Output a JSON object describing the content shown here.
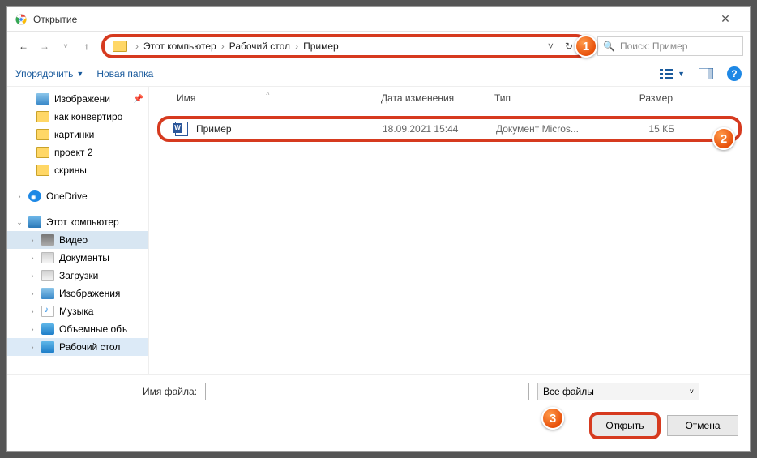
{
  "window": {
    "title": "Открытие"
  },
  "breadcrumb": {
    "p1": "Этот компьютер",
    "p2": "Рабочий стол",
    "p3": "Пример"
  },
  "search": {
    "placeholder": "Поиск: Пример"
  },
  "toolbar": {
    "organize": "Упорядочить",
    "newfolder": "Новая папка"
  },
  "sidebar": {
    "items": [
      {
        "label": "Изображени"
      },
      {
        "label": "как конвертиро"
      },
      {
        "label": "картинки"
      },
      {
        "label": "проект 2"
      },
      {
        "label": "скрины"
      },
      {
        "label": "OneDrive"
      },
      {
        "label": "Этот компьютер"
      },
      {
        "label": "Видео"
      },
      {
        "label": "Документы"
      },
      {
        "label": "Загрузки"
      },
      {
        "label": "Изображения"
      },
      {
        "label": "Музыка"
      },
      {
        "label": "Объемные объ"
      },
      {
        "label": "Рабочий стол"
      }
    ]
  },
  "columns": {
    "name": "Имя",
    "date": "Дата изменения",
    "type": "Тип",
    "size": "Размер"
  },
  "file": {
    "name": "Пример",
    "date": "18.09.2021 15:44",
    "type": "Документ Micros...",
    "size": "15 КБ"
  },
  "bottom": {
    "filename_label": "Имя файла:",
    "filter": "Все файлы",
    "open": "Открыть",
    "cancel": "Отмена"
  },
  "badges": {
    "b1": "1",
    "b2": "2",
    "b3": "3"
  }
}
